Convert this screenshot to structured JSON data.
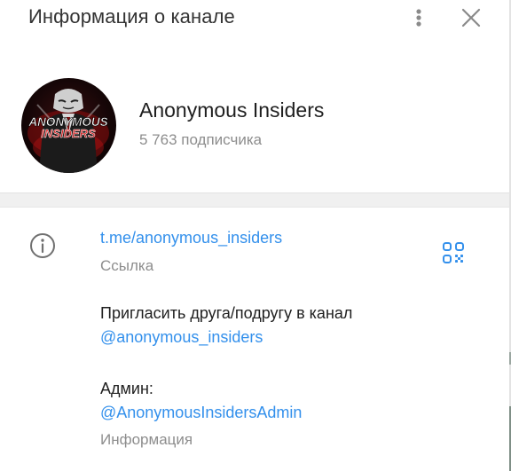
{
  "header": {
    "title": "Информация о канале"
  },
  "channel": {
    "name": "Anonymous Insiders",
    "subscribers": "5 763 подписчика",
    "avatar_text_line1": "ANONYMOUS",
    "avatar_text_line2": "INSIDERS"
  },
  "info": {
    "link_value": "t.me/anonymous_insiders",
    "link_caption": "Ссылка",
    "desc_line1": "Пригласить друга/подругу в канал",
    "desc_mention": "@anonymous_insiders",
    "admin_label": "Админ:",
    "admin_mention": "@AnonymousInsidersAdmin",
    "desc_caption": "Информация"
  },
  "icons": {
    "menu": "more-vertical-icon",
    "close": "close-icon",
    "info": "info-icon",
    "qr": "qr-code-icon"
  },
  "colors": {
    "accent": "#3390ec",
    "text": "#1f1f1f",
    "muted": "#8d8d8d"
  }
}
